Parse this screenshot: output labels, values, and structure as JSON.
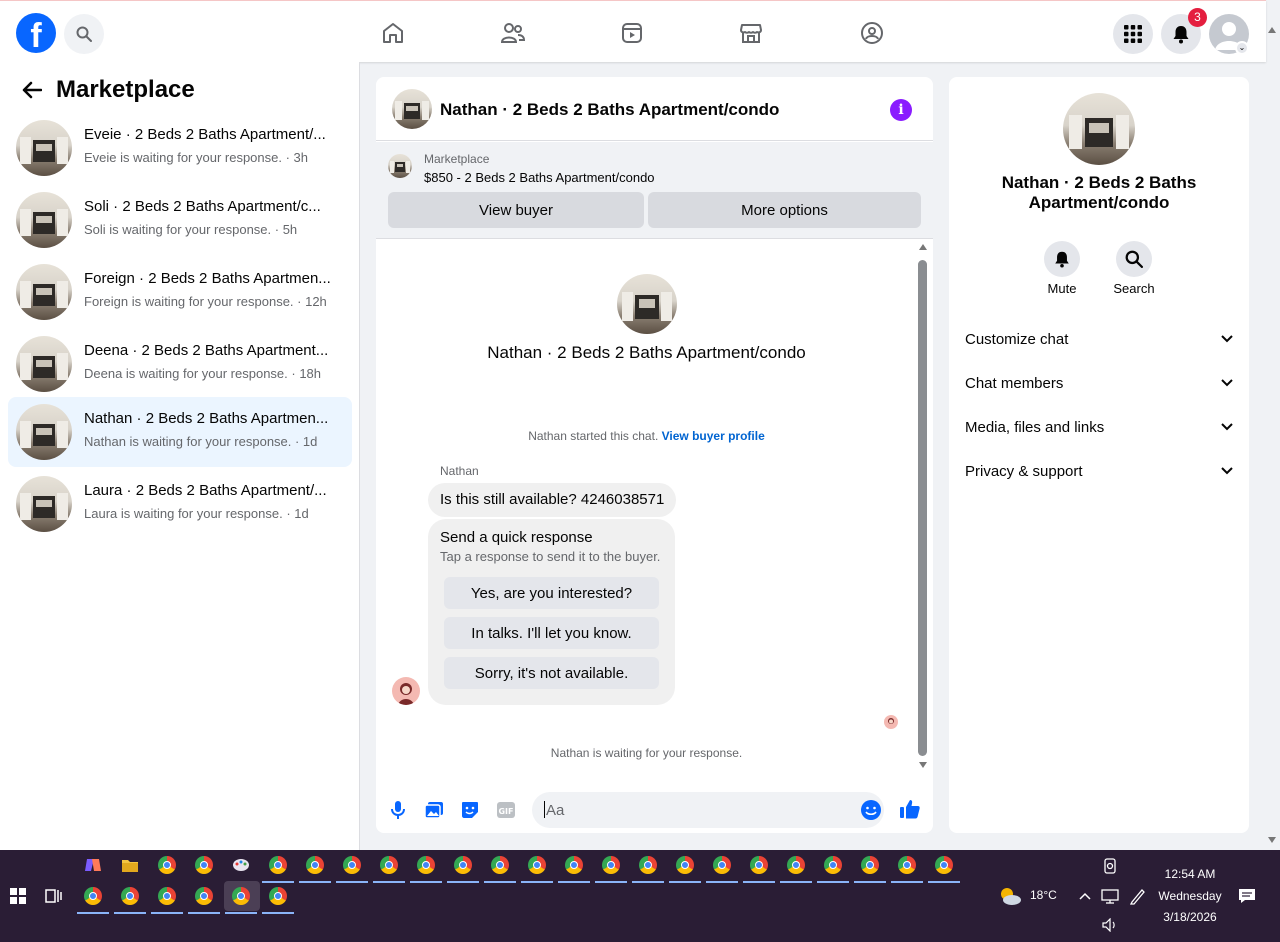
{
  "topbar": {
    "logo": "f",
    "notifications_badge": "3",
    "nav_icons": [
      "home-icon",
      "friends-icon",
      "video-icon",
      "marketplace-icon",
      "groups-icon"
    ]
  },
  "sidebar": {
    "title": "Marketplace",
    "conversations": [
      {
        "title": "Eveie · 2 Beds 2 Baths Apartment/...",
        "subtitle": "Eveie is waiting for your response. · 3h"
      },
      {
        "title": "Soli · 2 Beds 2 Baths Apartment/c...",
        "subtitle": "Soli is waiting for your response. · 5h"
      },
      {
        "title": "Foreign · 2 Beds 2 Baths Apartmen...",
        "subtitle": "Foreign is waiting for your response. · 12h"
      },
      {
        "title": "Deena · 2 Beds 2 Baths Apartment...",
        "subtitle": "Deena is waiting for your response. · 18h"
      },
      {
        "title": "Nathan · 2 Beds 2 Baths Apartmen...",
        "subtitle": "Nathan is waiting for your response. · 1d"
      },
      {
        "title": "Laura · 2 Beds 2 Baths Apartment/...",
        "subtitle": "Laura is waiting for your response. · 1d"
      }
    ]
  },
  "chat": {
    "header_title": "Nathan · 2 Beds 2 Baths Apartment/condo",
    "marketplace_label": "Marketplace",
    "listing": "$850 - 2 Beds 2 Baths Apartment/condo",
    "view_buyer": "View buyer",
    "more_options": "More options",
    "intro_title": "Nathan · 2 Beds 2 Baths Apartment/condo",
    "started_text": "Nathan started this chat.",
    "view_profile": "View buyer profile",
    "sender": "Nathan",
    "message": "Is this still available? 4246038571",
    "quick_title": "Send a quick response",
    "quick_sub": "Tap a response to send it to the buyer.",
    "quick_options": [
      "Yes, are you interested?",
      "In talks. I'll let you know.",
      "Sorry, it's not available."
    ],
    "waiting": "Nathan is waiting for your response.",
    "input_placeholder": "Aa"
  },
  "details": {
    "title": "Nathan · 2 Beds 2 Baths Apartment/condo",
    "mute": "Mute",
    "search": "Search",
    "sections": [
      "Customize chat",
      "Chat members",
      "Media, files and links",
      "Privacy & support"
    ]
  },
  "taskbar": {
    "temperature": "18°C",
    "time": "12:54 AM",
    "day": "Wednesday",
    "date": "3/18/2026"
  },
  "colors": {
    "facebook_blue": "#0866ff",
    "badge_red": "#e41e3f",
    "info_purple": "#8a1cff",
    "active_row": "#ebf5ff",
    "taskbar": "#2a1d35"
  }
}
